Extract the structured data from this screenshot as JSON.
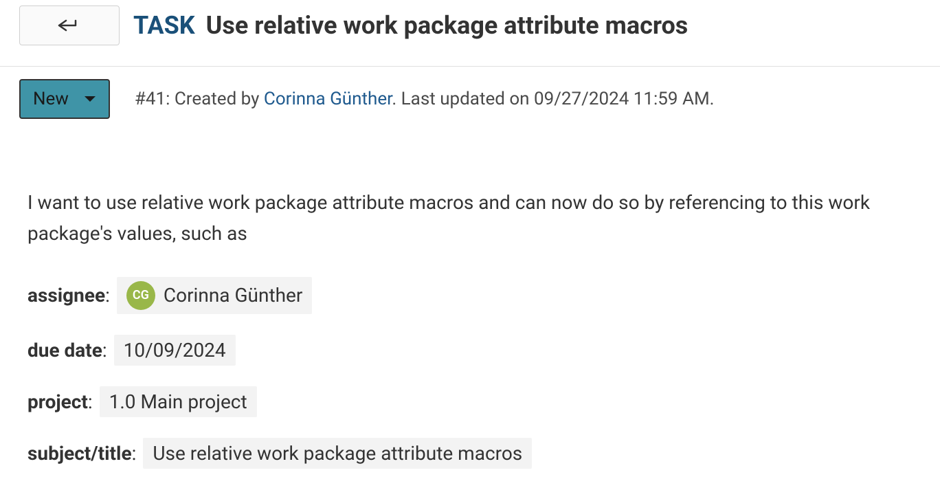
{
  "header": {
    "type_label": "TASK",
    "title": "Use relative work package attribute macros"
  },
  "status": {
    "label": "New"
  },
  "meta": {
    "id_prefix": "#41:",
    "created_by_prefix": "Created by ",
    "author": "Corinna Günther",
    "updated_prefix": ". Last updated on ",
    "updated_at": "09/27/2024 11:59 AM",
    "suffix": "."
  },
  "description": {
    "text": "I want to use relative work package attribute macros and can now do so by referencing to this work package's values, such as"
  },
  "attributes": {
    "assignee": {
      "label": "assignee",
      "avatar_initials": "CG",
      "value": "Corinna Günther"
    },
    "due_date": {
      "label": "due date",
      "value": "10/09/2024"
    },
    "project": {
      "label": "project",
      "value": "1.0 Main project"
    },
    "subject": {
      "label": "subject/title",
      "value": "Use relative work package attribute macros"
    }
  }
}
